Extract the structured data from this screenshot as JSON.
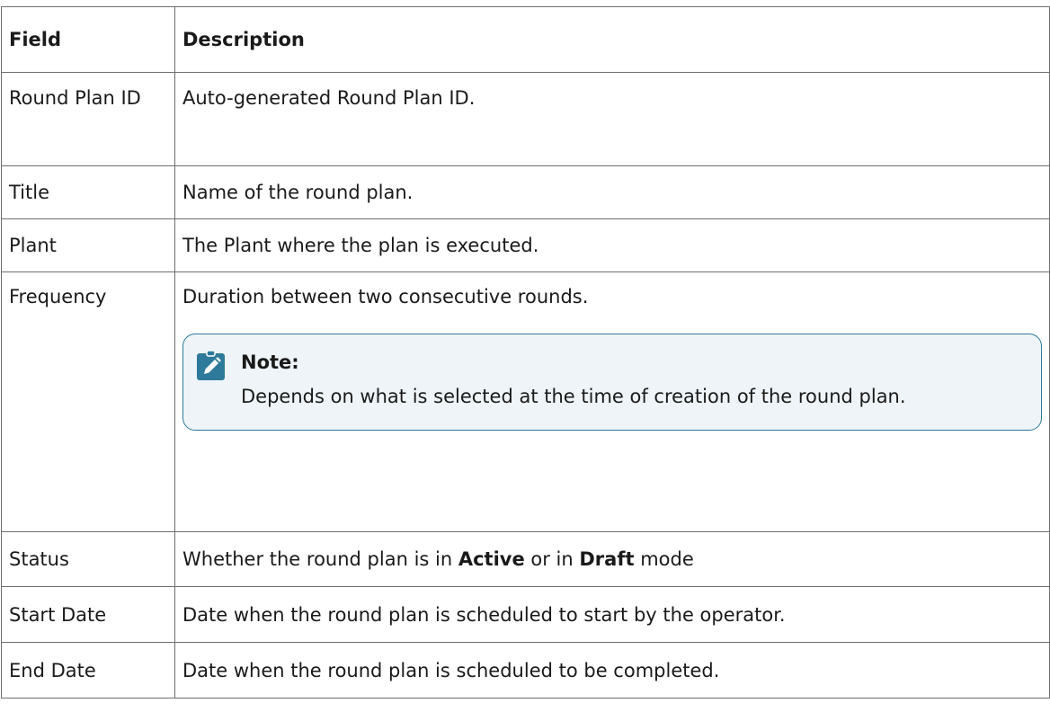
{
  "table": {
    "headers": [
      "Field",
      "Description"
    ],
    "rows": [
      {
        "field": "Round Plan ID",
        "description": "Auto-generated Round Plan ID."
      },
      {
        "field": "Title",
        "description": "Name of the round plan."
      },
      {
        "field": "Plant",
        "description": "The Plant where the plan is executed."
      },
      {
        "field": "Frequency",
        "description": "Duration between two consecutive rounds.",
        "note": {
          "label": "Note:",
          "text": "Depends on what is selected at the time of creation of the round plan.",
          "icon": "pencil-note-icon"
        }
      },
      {
        "field": "Status",
        "description_parts": [
          "Whether the round plan is in ",
          "Active",
          " or in ",
          "Draft",
          " mode"
        ]
      },
      {
        "field": "Start Date",
        "description": "Date when the round plan is scheduled to start by the operator."
      },
      {
        "field": "End Date",
        "description": "Date when the round plan is scheduled to be completed."
      }
    ]
  },
  "colors": {
    "note_border": "#2e7a9a",
    "note_background": "#eef4f7",
    "icon": "#2e7a9a",
    "grid": "#6e6e6e"
  }
}
